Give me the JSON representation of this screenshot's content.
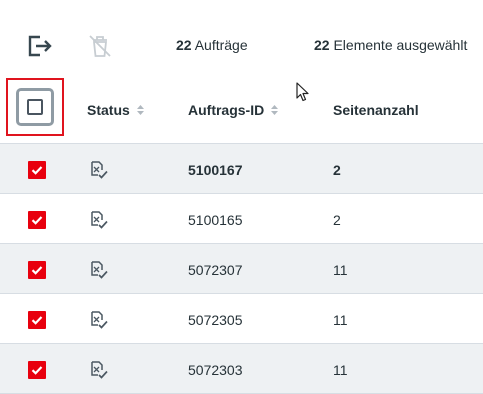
{
  "toolbar": {
    "icons": [
      "logout-icon",
      "delete-icon"
    ],
    "orders_count": "22",
    "orders_label": " Aufträge",
    "selected_count": "22",
    "selected_label": " Elemente ausgewählt"
  },
  "table": {
    "columns": [
      {
        "label": "Status"
      },
      {
        "label": "Auftrags-ID"
      },
      {
        "label": "Seitenanzahl"
      }
    ],
    "rows": [
      {
        "id": "5100167",
        "pages": "2",
        "checked": true
      },
      {
        "id": "5100165",
        "pages": "2",
        "checked": true
      },
      {
        "id": "5072307",
        "pages": "11",
        "checked": true
      },
      {
        "id": "5072305",
        "pages": "11",
        "checked": true
      },
      {
        "id": "5072303",
        "pages": "11",
        "checked": true
      }
    ]
  },
  "colors": {
    "checkbox_red": "#e8000e",
    "highlight_frame": "#e0141e",
    "row_alt_bg": "#eef1f3"
  }
}
